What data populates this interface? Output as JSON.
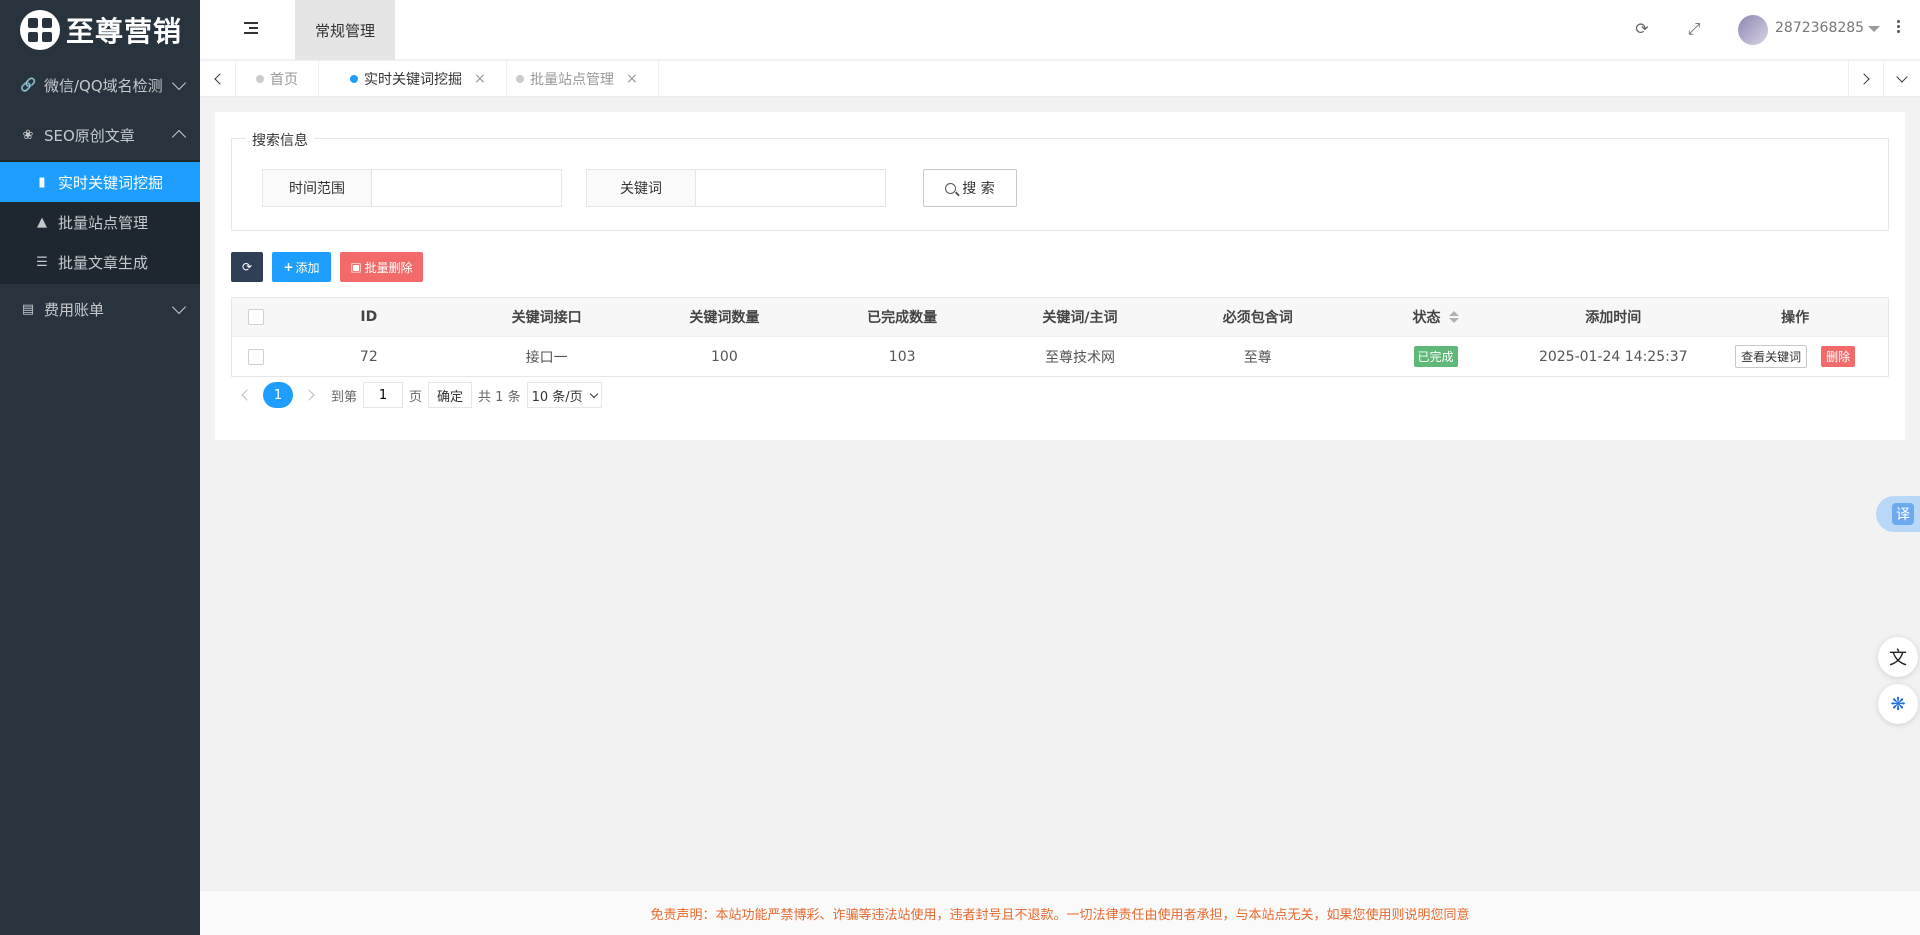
{
  "logo": {
    "text": "至尊营销"
  },
  "sidebar": {
    "groups": [
      {
        "label": "微信/QQ域名检测",
        "icon": "link-icon"
      },
      {
        "label": "SEO原创文章",
        "icon": "paw-icon"
      },
      {
        "label": "费用账单",
        "icon": "bill-icon"
      }
    ],
    "subitems": [
      {
        "label": "实时关键词挖掘",
        "icon": "book-icon"
      },
      {
        "label": "批量站点管理",
        "icon": "sitemap-icon"
      },
      {
        "label": "批量文章生成",
        "icon": "list-icon"
      }
    ]
  },
  "header": {
    "tab_label": "常规管理",
    "username": "2872368285"
  },
  "tabs": [
    {
      "label": "首页"
    },
    {
      "label": "实时关键词挖掘"
    },
    {
      "label": "批量站点管理"
    }
  ],
  "search": {
    "legend": "搜索信息",
    "time_label": "时间范围",
    "time_value": "",
    "keyword_label": "关键词",
    "keyword_value": "",
    "button_label": "搜 索"
  },
  "toolbar": {
    "add_label": "添加",
    "batch_delete_label": "批量删除"
  },
  "table": {
    "headers": [
      "ID",
      "关键词接口",
      "关键词数量",
      "已完成数量",
      "关键词/主词",
      "必须包含词",
      "状态",
      "添加时间",
      "操作"
    ],
    "rows": [
      {
        "id": "72",
        "api": "接口一",
        "count": "100",
        "done": "103",
        "main_word": "至尊技术网",
        "must_include": "至尊",
        "status": "已完成",
        "added_time": "2025-01-24 14:25:37",
        "view_label": "查看关键词",
        "delete_label": "删除"
      }
    ]
  },
  "pager": {
    "current": "1",
    "goto_label": "到第",
    "goto_value": "1",
    "page_unit": "页",
    "confirm_label": "确定",
    "total": "共 1 条",
    "per_page": "10 条/页"
  },
  "float": {
    "translate_label": "译"
  },
  "footer": {
    "disclaimer": "免责声明：本站功能严禁博彩、诈骗等违法站使用，违者封号且不退款。一切法律责任由使用者承担，与本站点无关，如果您使用则说明您同意"
  },
  "colors": {
    "sidebar_bg": "#28333e",
    "accent": "#1e9fff",
    "success": "#5fb878",
    "danger": "#f26a6a",
    "footer_text": "#e8692f"
  }
}
